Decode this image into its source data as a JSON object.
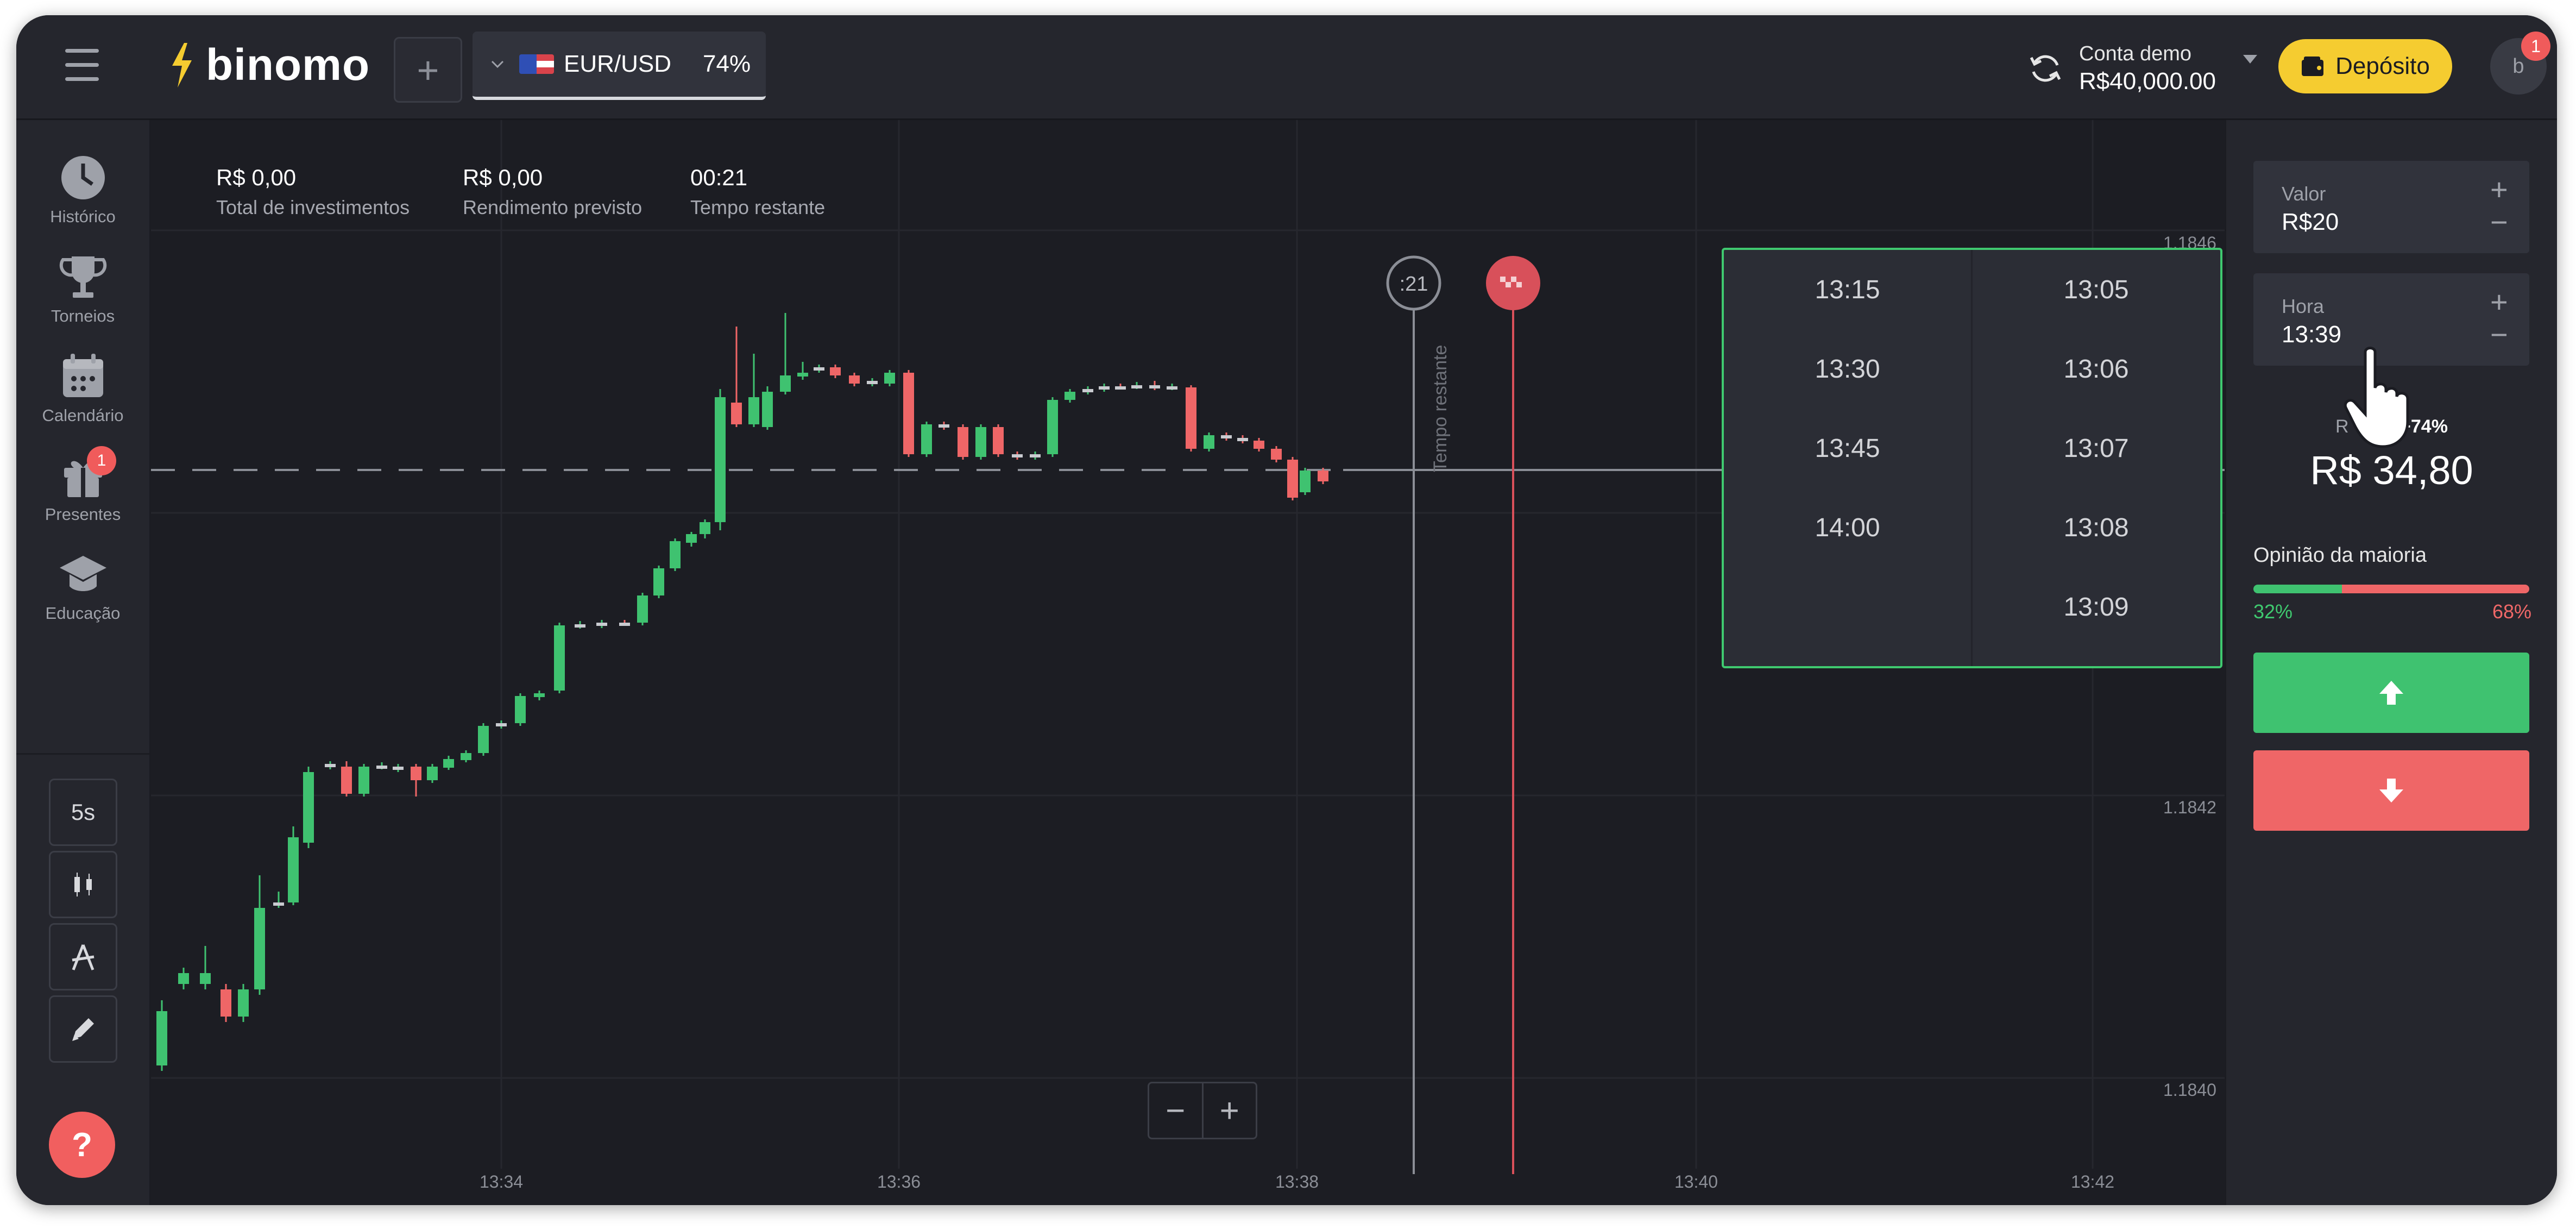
{
  "header": {
    "logo_text": "binomo",
    "asset": {
      "pair": "EUR/USD",
      "payout": "74%"
    },
    "account": {
      "label": "Conta demo",
      "balance": "R$40,000.00"
    },
    "deposit_label": "Depósito",
    "avatar_initial": "b",
    "notification_count": "1"
  },
  "sidebar": {
    "items": [
      {
        "label": "Histórico",
        "icon": "history-icon"
      },
      {
        "label": "Torneios",
        "icon": "trophy-icon"
      },
      {
        "label": "Calendário",
        "icon": "calendar-icon"
      },
      {
        "label": "Presentes",
        "icon": "gift-icon",
        "badge": "1"
      },
      {
        "label": "Educação",
        "icon": "graduation-cap-icon"
      }
    ],
    "timeframe_label": "5s",
    "help_label": "?"
  },
  "stats": {
    "investments": {
      "value": "R$ 0,00",
      "label": "Total de investimentos"
    },
    "expected": {
      "value": "R$ 0,00",
      "label": "Rendimento previsto"
    },
    "remaining": {
      "value": "00:21",
      "label": "Tempo restante"
    }
  },
  "chart": {
    "countdown_badge": ":21",
    "vertical_label": "Tempo restante"
  },
  "chart_data": {
    "type": "candlestick",
    "y_ticks": [
      "1.1846",
      "1.1842",
      "1.1840"
    ],
    "x_ticks": [
      "13:34",
      "13:36",
      "13:38",
      "13:40",
      "13:42"
    ],
    "current_price_level": "dashed horizontal line"
  },
  "time_dropdown": {
    "left_options": [
      "13:15",
      "13:30",
      "13:45",
      "14:00"
    ],
    "right_options": [
      "13:05",
      "13:06",
      "13:07",
      "13:08",
      "13:09"
    ]
  },
  "trade_panel": {
    "amount": {
      "label": "Valor",
      "value": "R$20"
    },
    "time": {
      "label": "Hora",
      "value": "13:39"
    },
    "profit_prefix": "R",
    "profit_pct": "+74%",
    "payout_value": "R$ 34,80",
    "majority": {
      "title": "Opinião da maioria",
      "up_pct": "32%",
      "down_pct": "68%",
      "up_fraction": 0.32
    },
    "colors": {
      "up": "#3fc270",
      "down": "#ef6667",
      "accent": "#f5cc30"
    }
  }
}
